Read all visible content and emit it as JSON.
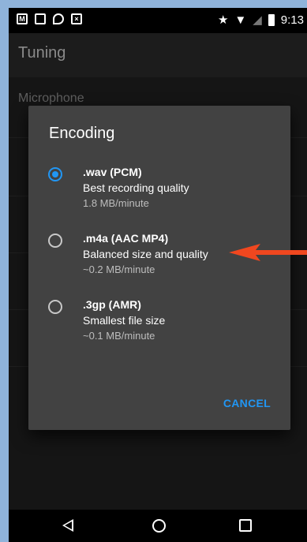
{
  "status_bar": {
    "time": "9:13",
    "left_icons": [
      "gmail-icon",
      "image-icon",
      "location-pin-icon",
      "close-box-icon"
    ],
    "right_icons": [
      "star-icon",
      "wifi-icon",
      "no-signal-icon",
      "battery-icon"
    ]
  },
  "app_bar": {
    "title": "Tuning"
  },
  "settings": {
    "microphone_label": "Microphone"
  },
  "dialog": {
    "title": "Encoding",
    "options": [
      {
        "title": ".wav (PCM)",
        "description": "Best recording quality",
        "size": "1.8 MB/minute",
        "selected": true
      },
      {
        "title": ".m4a (AAC MP4)",
        "description": "Balanced size and quality",
        "size": "~0.2 MB/minute",
        "selected": false
      },
      {
        "title": ".3gp (AMR)",
        "description": "Smallest file size",
        "size": "~0.1 MB/minute",
        "selected": false
      }
    ],
    "cancel_label": "CANCEL"
  },
  "colors": {
    "accent": "#2196f3",
    "annotation_arrow": "#f0471f",
    "dialog_bg": "#424242",
    "outer_bg": "#8fb3da"
  },
  "nav_bar": {
    "icons": [
      "back-icon",
      "home-icon",
      "recents-icon"
    ]
  }
}
